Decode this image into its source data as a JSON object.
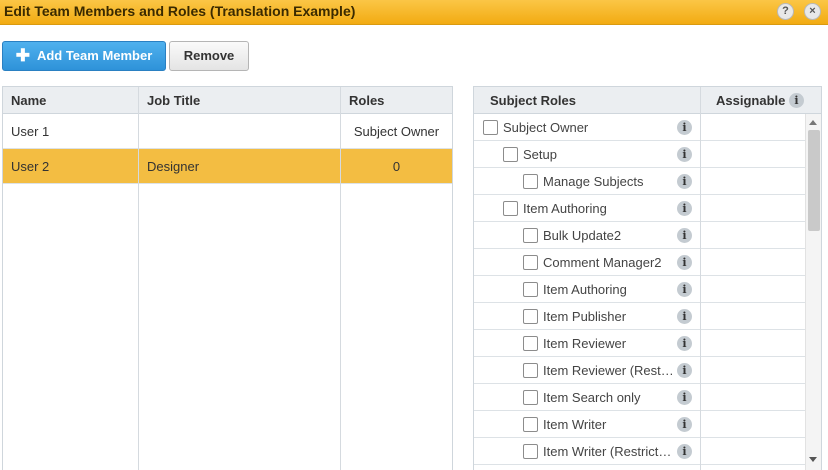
{
  "dialog": {
    "title": "Edit Team Members and Roles (Translation Example)",
    "help_label": "?",
    "close_label": "×"
  },
  "toolbar": {
    "add_icon": "plus-icon",
    "add_label": "Add Team Member",
    "remove_label": "Remove"
  },
  "members": {
    "columns": [
      "Name",
      "Job Title",
      "Roles"
    ],
    "rows": [
      {
        "name": "User 1",
        "job_title": "",
        "roles": "Subject Owner",
        "selected": false
      },
      {
        "name": "User 2",
        "job_title": "Designer",
        "roles": "0",
        "selected": true
      }
    ],
    "selected_color": "#f3bd42"
  },
  "roles_panel": {
    "columns": [
      "Subject Roles",
      "Assignable"
    ],
    "info_glyph": "i",
    "items": [
      {
        "label": "Subject Owner",
        "level": 0,
        "checked": false
      },
      {
        "label": "Setup",
        "level": 1,
        "checked": false
      },
      {
        "label": "Manage Subjects",
        "level": 2,
        "checked": false
      },
      {
        "label": "Item Authoring",
        "level": 1,
        "checked": false
      },
      {
        "label": "Bulk Update2",
        "level": 2,
        "checked": false
      },
      {
        "label": "Comment Manager2",
        "level": 2,
        "checked": false
      },
      {
        "label": "Item Authoring",
        "level": 2,
        "checked": false
      },
      {
        "label": "Item Publisher",
        "level": 2,
        "checked": false
      },
      {
        "label": "Item Reviewer",
        "level": 2,
        "checked": false
      },
      {
        "label": "Item Reviewer (Rest…",
        "level": 2,
        "checked": false
      },
      {
        "label": "Item Search only",
        "level": 2,
        "checked": false
      },
      {
        "label": "Item Writer",
        "level": 2,
        "checked": false
      },
      {
        "label": "Item Writer (Restrict…",
        "level": 2,
        "checked": false
      }
    ]
  },
  "colors": {
    "titlebar": "#f2ab12",
    "primary_button": "#2e92d9",
    "header_bg": "#ebeef1"
  }
}
